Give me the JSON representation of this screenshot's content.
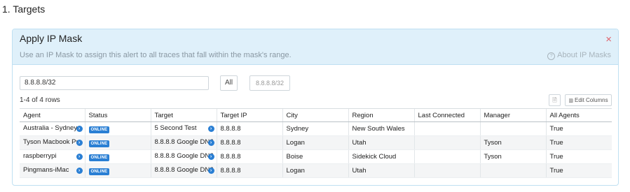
{
  "section": {
    "title": "1. Targets"
  },
  "card": {
    "title": "Apply IP Mask",
    "close_glyph": "×",
    "description": "Use an IP Mask to assign this alert to all traces that fall within the mask's range.",
    "about_label": "About IP Masks"
  },
  "mask": {
    "input_value": "8.8.8.8/32",
    "all_label": "All",
    "mask_button_label": "8.8.8.8/32"
  },
  "table_controls": {
    "row_count": "1-4 of 4 rows",
    "edit_columns_label": "Edit Columns"
  },
  "table": {
    "headers": [
      "Agent",
      "Status",
      "Target",
      "Target IP",
      "City",
      "Region",
      "Last Connected",
      "Manager",
      "All Agents"
    ],
    "rows": [
      {
        "agent": "Australia - Sydney",
        "status": "ONLINE",
        "target": "5 Second Test",
        "target_ip": "8.8.8.8",
        "city": "Sydney",
        "region": "New South Wales",
        "last_connected": "",
        "manager": "",
        "all_agents": "True"
      },
      {
        "agent": "Tyson Macbook Pro",
        "status": "ONLINE",
        "target": "8.8.8.8 Google DNS",
        "target_ip": "8.8.8.8",
        "city": "Logan",
        "region": "Utah",
        "last_connected": "",
        "manager": "Tyson",
        "all_agents": "True"
      },
      {
        "agent": "raspberrypi",
        "status": "ONLINE",
        "target": "8.8.8.8 Google DNS",
        "target_ip": "8.8.8.8",
        "city": "Boise",
        "region": "Sidekick Cloud",
        "last_connected": "",
        "manager": "Tyson",
        "all_agents": "True"
      },
      {
        "agent": "Pingmans-iMac",
        "status": "ONLINE",
        "target": "8.8.8.8 Google DNS",
        "target_ip": "8.8.8.8",
        "city": "Logan",
        "region": "Utah",
        "last_connected": "",
        "manager": "",
        "all_agents": "True"
      }
    ]
  },
  "colors": {
    "header_bg": "#dff0fa",
    "accent": "#2a7fd4",
    "close": "#e0626b",
    "row_alt": "#f4f5f6"
  },
  "icons": {
    "close": "close-icon",
    "help": "help-icon",
    "go": "arrow-right-circle-icon",
    "export": "document-icon",
    "columns": "columns-icon"
  }
}
